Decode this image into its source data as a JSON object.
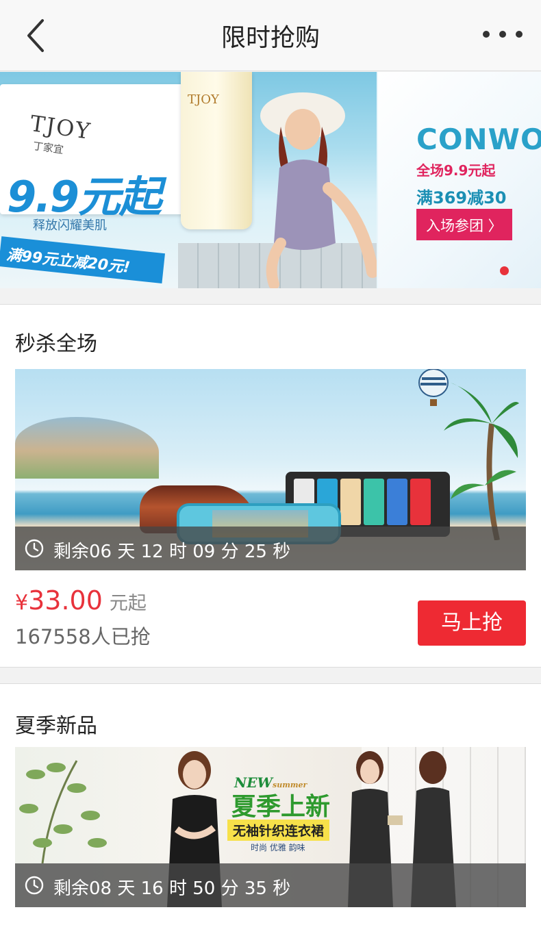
{
  "header": {
    "title": "限时抢购",
    "back_icon": "chevron-left-icon",
    "more_icon": "more-horizontal-icon"
  },
  "banner": {
    "slides": [
      {
        "brand_logo": "TJOY",
        "brand_sub": "丁家宜",
        "tube_text": "TJOY",
        "headline": "9.9元起",
        "slogan": "释放闪耀美肌",
        "ribbon": "满99元立减20元!"
      },
      {
        "brand": "CONWO",
        "line1": "全场9.9元起",
        "line2": "满369减30",
        "button": "入场参团 〉"
      }
    ],
    "active_index": 1,
    "slide_count": 2,
    "indicator_color": "#e8323b"
  },
  "sections": [
    {
      "title": "秒杀全场",
      "image": "car-electronics-beach-banner",
      "timer_icon": "clock-icon",
      "countdown": "剩余06 天 12 时 09 分 25 秒",
      "price_currency": "¥",
      "price_value": "33.00",
      "price_suffix": "元起",
      "grabbed": "167558人已抢",
      "button": "马上抢"
    },
    {
      "title": "夏季新品",
      "image": "summer-dress-banner",
      "banner_new": "NEW",
      "banner_summer": "summer",
      "banner_title": "夏季上新",
      "banner_sub": "无袖针织连衣裙",
      "banner_tag": "时尚 优雅 韵味",
      "timer_icon": "clock-icon",
      "countdown": "剩余08 天 16 时 50 分 35 秒"
    }
  ],
  "colors": {
    "accent": "#ee2a33",
    "price": "#e8323b",
    "background": "#f2f2f2"
  }
}
